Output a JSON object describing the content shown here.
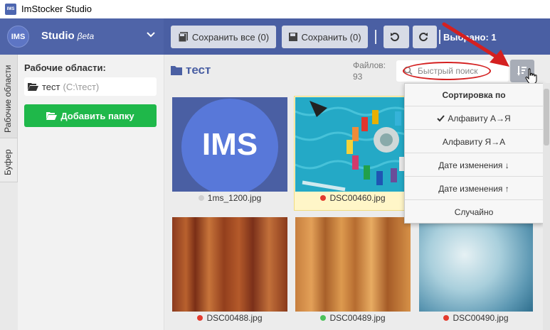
{
  "window": {
    "title": "ImStocker Studio",
    "icon_text": "IMS"
  },
  "brand": {
    "logo_text": "IMS",
    "name": "Studio",
    "badge": "βeta"
  },
  "toolbar": {
    "save_all_label": "Сохранить все (0)",
    "save_label": "Сохранить (0)",
    "selected_label": "Выбрано: 1"
  },
  "vtabs": {
    "workspaces": "Рабочие области",
    "buffer": "Буфер"
  },
  "left": {
    "title": "Рабочие области:",
    "workspace": {
      "name": "тест",
      "path": "(C:\\тест)"
    },
    "add_folder_label": "Добавить папку"
  },
  "main": {
    "folder_title": "тест",
    "files_label": "Файлов:",
    "files_count": "93",
    "search_placeholder": "Быстрый поиск"
  },
  "sort_menu": {
    "header": "Сортировка по",
    "items": [
      {
        "label": "Алфавиту А→Я",
        "checked": true
      },
      {
        "label": "Алфавиту Я→А",
        "checked": false
      },
      {
        "label": "Дате изменения ↓",
        "checked": false
      },
      {
        "label": "Дате изменения ↑",
        "checked": false
      },
      {
        "label": "Случайно",
        "checked": false
      }
    ]
  },
  "thumbnails": [
    {
      "name": "1ms_1200.jpg",
      "status": "gray",
      "color": "#d0d0d0",
      "art_text": "IMS"
    },
    {
      "name": "DSC00460.jpg",
      "status": "red",
      "color": "#e33b2e",
      "selected": true
    },
    {
      "name": "DSC00488.jpg",
      "status": "red",
      "color": "#e33b2e"
    },
    {
      "name": "DSC00489.jpg",
      "status": "green",
      "color": "#4cc25a"
    },
    {
      "name": "DSC00490.jpg",
      "status": "red",
      "color": "#e33b2e"
    }
  ],
  "colors": {
    "appbar": "#4a5fa3",
    "accent_green": "#1fb84a",
    "annotation_red": "#d42020"
  }
}
